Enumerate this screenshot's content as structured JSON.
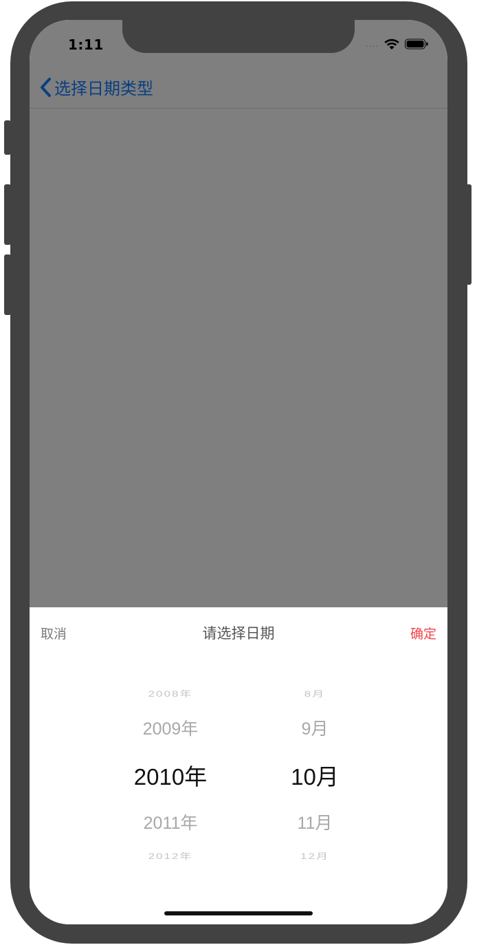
{
  "status_bar": {
    "time": "1:11",
    "signal": "....",
    "wifi_icon": "wifi-icon",
    "battery_icon": "battery-icon"
  },
  "nav": {
    "back_label": "选择日期类型",
    "back_icon": "chevron-left-icon"
  },
  "sheet": {
    "cancel_label": "取消",
    "title": "请选择日期",
    "confirm_label": "确定",
    "year_rows": [
      "2008年",
      "2009年",
      "2010年",
      "2011年",
      "2012年"
    ],
    "month_rows": [
      "8月",
      "9月",
      "10月",
      "11月",
      "12月"
    ],
    "selected_year": "2010年",
    "selected_month": "10月"
  },
  "colors": {
    "accent_blue": "#0a3f82",
    "confirm_red": "#f0444a",
    "overlay": "#7f7f7f",
    "frame": "#424242"
  }
}
